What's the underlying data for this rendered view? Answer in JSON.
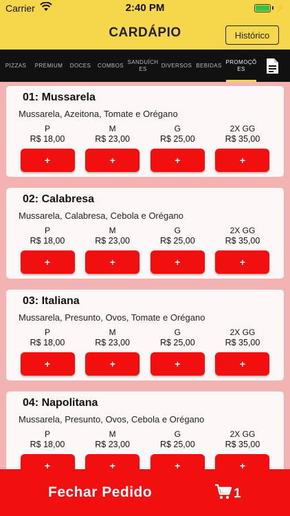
{
  "status": {
    "carrier": "Carrier",
    "time": "2:40 PM"
  },
  "nav": {
    "title": "CARDÁPIO",
    "history_button": "Histórico"
  },
  "tabs": [
    "PIZZAS",
    "PREMIUM",
    "DOCES",
    "COMBOS",
    "SANDUÍCH ES",
    "DIVERSOS",
    "BEBIDAS",
    "PROMOÇÕ ES"
  ],
  "active_tab": "PROMOÇÕ ES",
  "sizes": [
    "P",
    "M",
    "G",
    "2X GG"
  ],
  "add_label": "+",
  "items": [
    {
      "title": "01: Mussarela",
      "desc": "Mussarela, Azeitona, Tomate e Orégano",
      "prices": [
        "R$ 18,00",
        "R$ 23,00",
        "R$ 25,00",
        "R$ 35,00"
      ]
    },
    {
      "title": "02: Calabresa",
      "desc": "Mussarela, Calabresa, Cebola e Orégano",
      "prices": [
        "R$ 18,00",
        "R$ 23,00",
        "R$ 25,00",
        "R$ 35,00"
      ]
    },
    {
      "title": "03: Italiana",
      "desc": "Mussarela, Presunto, Ovos, Tomate e Orégano",
      "prices": [
        "R$ 18,00",
        "R$ 23,00",
        "R$ 25,00",
        "R$ 35,00"
      ]
    },
    {
      "title": "04: Napolitana",
      "desc": "Mussarela, Presunto, Ovos, Cebola e Orégano",
      "prices": [
        "R$ 18,00",
        "R$ 23,00",
        "R$ 25,00",
        "R$ 35,00"
      ]
    }
  ],
  "footer": {
    "label": "Fechar Pedido",
    "cart_count": "1"
  },
  "colors": {
    "header": "#f6d64a",
    "tabbar": "#111111",
    "accent_red": "#f20f0f",
    "background": "#f4b3b3"
  }
}
